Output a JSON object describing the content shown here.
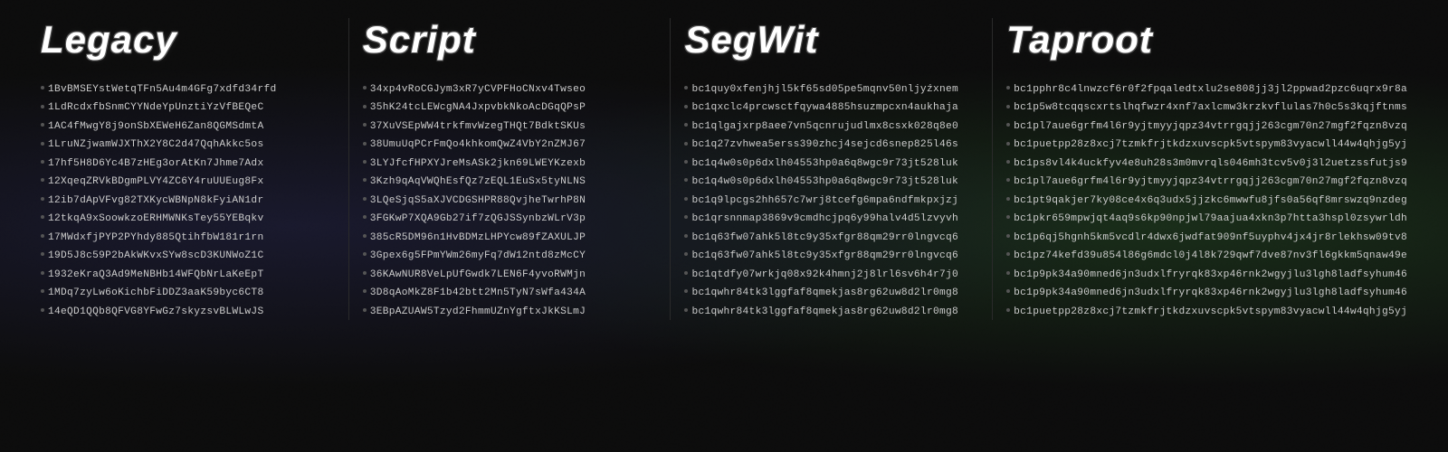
{
  "columns": [
    {
      "id": "legacy",
      "title": "Legacy",
      "addresses": [
        "1BvBMSEYstWetqTFn5Au4m4GFg7xdfd34rfd",
        "1LdRcdxfbSnmCYYNdeYpUnztiYzVfBEQeC",
        "1AC4fMwgY8j9onSbXEWeH6Zan8QGMSdmtA",
        "1LruNZjwamWJXThX2Y8C2d47QqhAkkc5os",
        "17hf5H8D6Yc4B7zHEg3orAtKn7Jhme7Adx",
        "12XqeqZRVkBDgmPLVY4ZC6Y4ruUUEug8Fx",
        "12ib7dApVFvg82TXKycWBNpN8kFyiAN1dr",
        "12tkqA9xSoowkzoERHMWNKsTey55YEBqkv",
        "17MWdxfjPYP2PYhdy885QtihfbW181r1rn",
        "19D5J8c59P2bAkWKvxSYw8scD3KUNWoZ1C",
        "1932eKraQ3Ad9MeNBHb14WFQbNrLaKeEpT",
        "1MDq7zyLw6oKichbFiDDZ3aaK59byc6CT8",
        "14eQD1QQb8QFVG8YFwGz7skyzsvBLWLwJS"
      ]
    },
    {
      "id": "script",
      "title": "Script",
      "addresses": [
        "34xp4vRoCGJym3xR7yCVPFHoCNxv4Twseo",
        "35hK24tcLEWcgNA4JxpvbkNkoAcDGqQPsP",
        "37XuVSEpWW4trkfmvWzegTHQt7BdktSKUs",
        "38UmuUqPCrFmQo4khkomQwZ4VbY2nZMJ67",
        "3LYJfcfHPXYJreMsASk2jkn69LWEYKzexb",
        "3Kzh9qAqVWQhEsfQz7zEQL1EuSx5tyNLNS",
        "3LQeSjqS5aXJVCDGSHPR88QvjheTwrhP8N",
        "3FGKwP7XQA9Gb27if7zQGJSSynbzWLrV3p",
        "385cR5DM96n1HvBDMzLHPYcw89fZAXULJP",
        "3Gpex6g5FPmYWm26myFq7dW12ntd8zMcCY",
        "36KAwNUR8VeLpUfGwdk7LEN6F4yvoRWMjn",
        "3D8qAoMkZ8F1b42btt2Mn5TyN7sWfa434A",
        "3EBpAZUAW5Tzyd2FhmmUZnYgftxJkKSLmJ"
      ]
    },
    {
      "id": "segwit",
      "title": "SegWit",
      "addresses": [
        "bc1quy0xfenjhjl5kf65sd05pe5mqnv50nljyźxnem",
        "bc1qxclc4prcwsctfqywa4885hsuzmpcxn4aukhaja",
        "bc1qlgajxrp8aee7vn5qcnrujudlmx8csxk028q8e0",
        "bc1q27zvhwea5erss390zhcj4sejcd6snep825l46s",
        "bc1q4w0s0p6dxlh04553hp0a6q8wgc9r73jt528luk",
        "bc1q4w0s0p6dxlh04553hp0a6q8wgc9r73jt528luk",
        "bc1q9lpcgs2hh657c7wrj8tcefg6mpa6ndfmkpxjzj",
        "bc1qrsnnmap3869v9cmdhcjpq6y99halv4d5lzvyvh",
        "bc1q63fw07ahk5l8tc9y35xfgr88qm29rr0lngvcq6",
        "bc1q63fw07ahk5l8tc9y35xfgr88qm29rr0lngvcq6",
        "bc1qtdfy07wrkjq08x92k4hmnj2j8lrl6sv6h4r7j0",
        "bc1qwhr84tk3lggfaf8qmekjas8rg62uw8d2lr0mg8",
        "bc1qwhr84tk3lggfaf8qmekjas8rg62uw8d2lr0mg8"
      ]
    },
    {
      "id": "taproot",
      "title": "Taproot",
      "addresses": [
        "bc1pphr8c4lnwzcf6r0f2fpqaledtxlu2se808jj3jl2ppwad2pzc6uqrx9r8a",
        "bc1p5w8tcqqscxrtslhqfwzr4xnf7axlcmw3krzkvflulas7h0c5s3kqjftnms",
        "bc1pl7aue6grfm4l6r9yjtmyyjqpz34vtrrgqjj263cgm70n27mgf2fqzn8vzq",
        "bc1puetpp28z8xcj7tzmkfrjtkdzxuvscpk5vtspym83vyacwll44w4qhjg5yj",
        "bc1ps8vl4k4uckfyv4e8uh28s3m0mvrqls046mh3tcv5v0j3l2uetzssfutjs9",
        "bc1pl7aue6grfm4l6r9yjtmyyjqpz34vtrrgqjj263cgm70n27mgf2fqzn8vzq",
        "bc1pt9qakjer7ky08ce4x6q3udx5jjzkc6mwwfu8jfs0a56qf8mrswzq9nzdeg",
        "bc1pkr659mpwjqt4aq9s6kp90npjwl79aajua4xkn3p7htta3hspl0zsywrldh",
        "bc1p6qj5hgnh5km5vcdlr4dwx6jwdfat909nf5uyphv4jx4jr8rlekhsw09tv8",
        "bc1pz74kefd39u854l86g6mdcl0j4l8k729qwf7dve87nv3fl6gkkm5qnaw49e",
        "bc1p9pk34a90mned6jn3udxlfryrqk83xp46rnk2wgyjlu3lgh8ladfsyhum46",
        "bc1p9pk34a90mned6jn3udxlfryrqk83xp46rnk2wgyjlu3lgh8ladfsyhum46",
        "bc1puetpp28z8xcj7tzmkfrjtkdzxuvscpk5vtspym83vyacwll44w4qhjg5yj"
      ]
    }
  ]
}
